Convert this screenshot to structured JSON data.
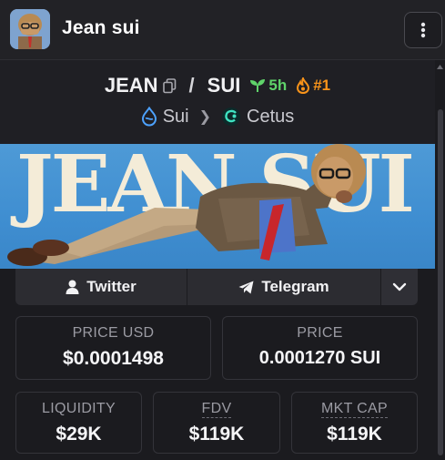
{
  "header": {
    "title": "Jean sui",
    "menu_icon": "vertical-dots-icon"
  },
  "pair": {
    "base": "JEAN",
    "separator": "/",
    "quote": "SUI",
    "age": "5h",
    "rank": "#1",
    "age_color": "#5fd36a",
    "rank_color": "#f7931a"
  },
  "chain": {
    "network": "Sui",
    "dex": "Cetus"
  },
  "banner": {
    "text": "JEAN SUI"
  },
  "socials": {
    "twitter": "Twitter",
    "telegram": "Telegram"
  },
  "stats": {
    "price_usd_label": "PRICE USD",
    "price_usd": "$0.0001498",
    "price_label": "PRICE",
    "price": "0.0001270 SUI",
    "liquidity_label": "LIQUIDITY",
    "liquidity": "$29K",
    "fdv_label": "FDV",
    "fdv": "$119K",
    "mktcap_label": "MKT CAP",
    "mktcap": "$119K"
  }
}
